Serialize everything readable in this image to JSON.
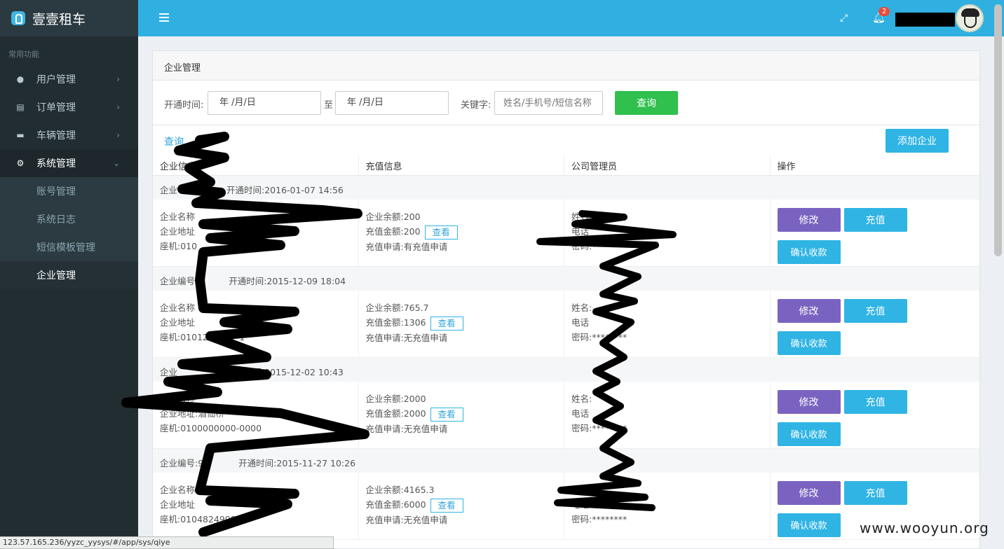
{
  "brand": {
    "name": "壹壹租车"
  },
  "sidebar": {
    "header": "常用功能",
    "items": [
      {
        "label": "用户管理",
        "icon": "user-icon"
      },
      {
        "label": "订单管理",
        "icon": "list-icon"
      },
      {
        "label": "车辆管理",
        "icon": "car-icon"
      },
      {
        "label": "系统管理",
        "icon": "gear-icon"
      }
    ],
    "sub_items": [
      {
        "label": "账号管理"
      },
      {
        "label": "系统日志"
      },
      {
        "label": "短信模板管理"
      },
      {
        "label": "企业管理"
      }
    ]
  },
  "topbar": {
    "badge": "2"
  },
  "panel": {
    "title": "企业管理"
  },
  "filter": {
    "open_time_label": "开通时间:",
    "date_from": "年 /月/日",
    "to_label": "至",
    "date_to": "年 /月/日",
    "keyword_label": "关键字:",
    "keyword_placeholder": "姓名/手机号/短信名称",
    "query_button": "查询"
  },
  "results": {
    "link": "查询",
    "add_button": "添加企业"
  },
  "table": {
    "columns": [
      "企业信息",
      "充值信息",
      "公司管理员",
      "操作"
    ],
    "groups": [
      {
        "head_id": "企业",
        "open_time": "开通时间:2016-01-07 14:56",
        "info": [
          "企业名称",
          "企业地址",
          "座机:010"
        ],
        "balance": "企业余额:200",
        "amount": "充值金额:200",
        "request": "充值申请:有充值申请",
        "admin": [
          "姓名:",
          "电话",
          "密码:********"
        ]
      },
      {
        "head_id": "企业编号:",
        "open_time": "开通时间:2015-12-09 18:04",
        "info": [
          "企业名称",
          "企业地址",
          "座机:0101234567-1"
        ],
        "balance": "企业余额:765.7",
        "amount": "充值金额:1306",
        "request": "充值申请:无充值申请",
        "admin": [
          "姓名:",
          "电话",
          "密码:********"
        ]
      },
      {
        "head_id": "企业",
        "open_time": "开通时间:2015-12-02 10:43",
        "info": [
          "企业名称",
          "企业地址:酒仙桥",
          "座机:0100000000-0000"
        ],
        "balance": "企业余额:2000",
        "amount": "充值金额:2000",
        "request": "充值申请:无充值申请",
        "admin": [
          "姓名:",
          "电话",
          "密码:********"
        ]
      },
      {
        "head_id": "企业编号:9",
        "open_time": "开通时间:2015-11-27 10:26",
        "info": [
          "企业名称",
          "企业地址",
          "座机:0104824998-"
        ],
        "balance": "企业余额:4165.3",
        "amount": "充值金额:6000",
        "request": "充值申请:无充值申请",
        "admin": [
          "姓名:",
          "电话",
          "密码:********"
        ]
      }
    ],
    "view_button": "查看",
    "edit_button": "修改",
    "charge_button": "充值",
    "confirm_button": "确认收款"
  },
  "statusbar": {
    "url": "123.57.165.236/yyzc_yysys/#/app/sys/qiye"
  },
  "watermark": "www.wooyun.org"
}
